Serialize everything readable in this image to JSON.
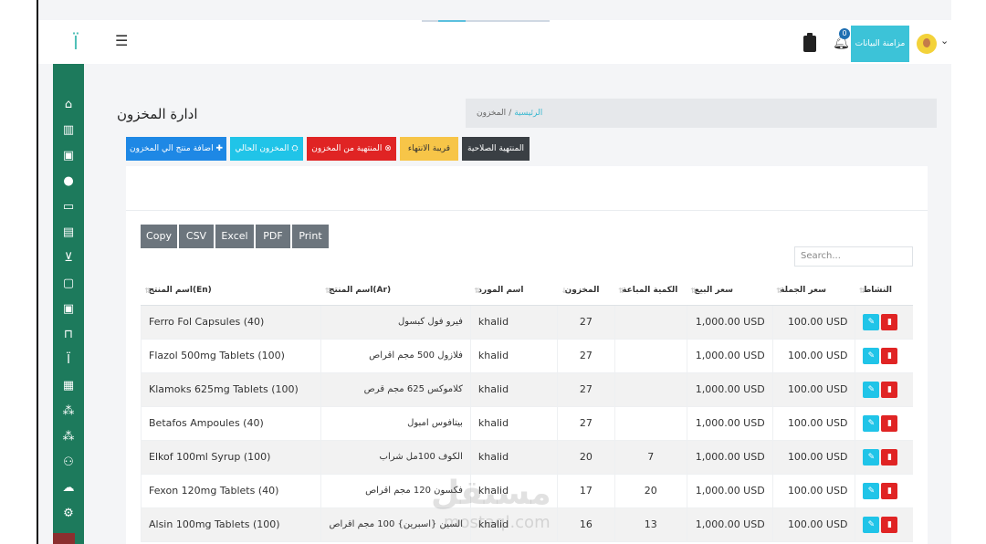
{
  "topbar": {
    "sync_label": "مزامنة البيانات",
    "notification_count": "0"
  },
  "page": {
    "title": "ادارة المخزون"
  },
  "breadcrumb": {
    "home": "الرئيسية",
    "separator": "/",
    "current": "المخزون"
  },
  "actions": {
    "add": "اضافة منتج الي المخزون",
    "current": "المخزون الحالي",
    "expired": "المنتهية من المخزون",
    "near_expiry": "قريبة الانتهاء",
    "expired_validity": "المنتهية الصلاحية"
  },
  "colors": {
    "add": "#1e88e5",
    "current": "#20c4e8",
    "expired": "#e02424",
    "near_expiry": "#f7c548",
    "expired_validity": "#3a3f44"
  },
  "export_buttons": [
    "Copy",
    "CSV",
    "Excel",
    "PDF",
    "Print"
  ],
  "search": {
    "placeholder": "Search..."
  },
  "table": {
    "headers": {
      "name_en": "(En)اسم المنتج",
      "name_ar": "(Ar)اسم المنتج",
      "supplier": "اسم المورد",
      "stock": "المخزون",
      "sold": "الكمية المباعة",
      "sale_price": "سعر البيع",
      "wholesale": "سعر الجملة",
      "activity": "النشاط"
    },
    "rows": [
      {
        "name_en": "Ferro Fol Capsules (40)",
        "name_ar": "فيرو فول كبسول",
        "supplier": "khalid",
        "stock": "27",
        "sold": "",
        "sale_price": "1,000.00 USD",
        "wholesale": "100.00 USD"
      },
      {
        "name_en": "Flazol 500mg Tablets (100)",
        "name_ar": "فلازول 500 مجم اقراص",
        "supplier": "khalid",
        "stock": "27",
        "sold": "",
        "sale_price": "1,000.00 USD",
        "wholesale": "100.00 USD"
      },
      {
        "name_en": "Klamoks 625mg Tablets (100)",
        "name_ar": "كلاموكس 625 مجم قرص",
        "supplier": "khalid",
        "stock": "27",
        "sold": "",
        "sale_price": "1,000.00 USD",
        "wholesale": "100.00 USD"
      },
      {
        "name_en": "Betafos Ampoules (40)",
        "name_ar": "بيتافوس امبول",
        "supplier": "khalid",
        "stock": "27",
        "sold": "",
        "sale_price": "1,000.00 USD",
        "wholesale": "100.00 USD"
      },
      {
        "name_en": "Elkof 100ml Syrup (100)",
        "name_ar": "الكوف 100مل شراب",
        "supplier": "khalid",
        "stock": "20",
        "sold": "7",
        "sale_price": "1,000.00 USD",
        "wholesale": "100.00 USD"
      },
      {
        "name_en": "Fexon 120mg Tablets (40)",
        "name_ar": "فكسون 120 مجم اقراص",
        "supplier": "khalid",
        "stock": "17",
        "sold": "20",
        "sale_price": "1,000.00 USD",
        "wholesale": "100.00 USD"
      },
      {
        "name_en": "Alsin 100mg Tablets (100)",
        "name_ar": "السين {اسبرين} 100 مجم اقراص",
        "supplier": "khalid",
        "stock": "16",
        "sold": "13",
        "sale_price": "1,000.00 USD",
        "wholesale": "100.00 USD"
      }
    ]
  },
  "watermark": {
    "arabic": "مستقل",
    "latin": "mostaql.com"
  }
}
